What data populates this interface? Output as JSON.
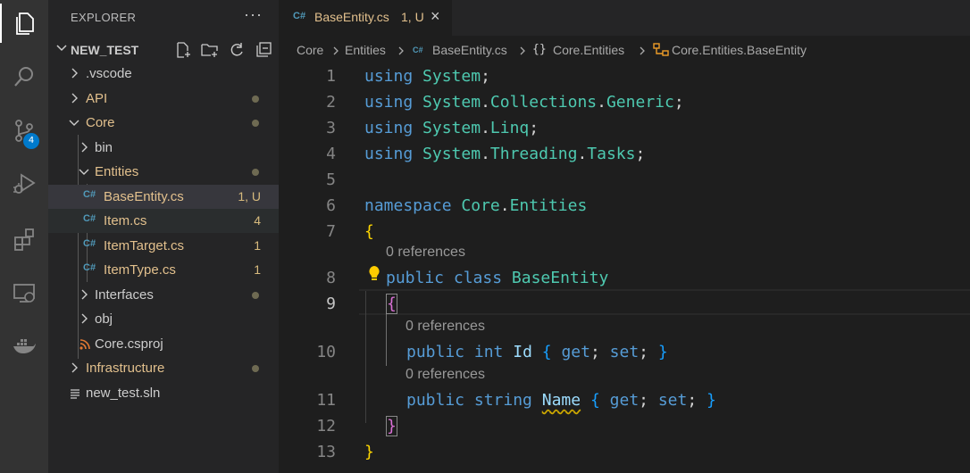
{
  "activity_bar": {
    "items": [
      {
        "name": "explorer",
        "icon": "files-icon",
        "active": true
      },
      {
        "name": "search",
        "icon": "search-icon"
      },
      {
        "name": "source-control",
        "icon": "source-control-icon",
        "badge": "4"
      },
      {
        "name": "run-debug",
        "icon": "run-debug-icon"
      },
      {
        "name": "extensions",
        "icon": "extensions-icon"
      },
      {
        "name": "remote-explorer",
        "icon": "remote-explorer-icon"
      },
      {
        "name": "docker",
        "icon": "docker-icon"
      }
    ]
  },
  "sidebar": {
    "title": "EXPLORER",
    "more": "···",
    "root": "NEW_TEST",
    "tree": [
      {
        "label": ".vscode",
        "type": "folder",
        "status": ""
      },
      {
        "label": "API",
        "type": "folder",
        "status": "dot"
      },
      {
        "label": "Core",
        "type": "folder",
        "status": "dot",
        "open": true
      },
      {
        "label": "bin",
        "type": "folder",
        "status": ""
      },
      {
        "label": "Entities",
        "type": "folder",
        "status": "dot",
        "open": true
      },
      {
        "label": "BaseEntity.cs",
        "type": "cs",
        "status": "1, U"
      },
      {
        "label": "Item.cs",
        "type": "cs",
        "status": "4"
      },
      {
        "label": "ItemTarget.cs",
        "type": "cs",
        "status": "1"
      },
      {
        "label": "ItemType.cs",
        "type": "cs",
        "status": "1"
      },
      {
        "label": "Interfaces",
        "type": "folder",
        "status": "dot"
      },
      {
        "label": "obj",
        "type": "folder",
        "status": ""
      },
      {
        "label": "Core.csproj",
        "type": "rss",
        "status": ""
      },
      {
        "label": "Infrastructure",
        "type": "folder",
        "status": "dot"
      },
      {
        "label": "new_test.sln",
        "type": "sln",
        "status": ""
      }
    ]
  },
  "tab": {
    "icon": "C#",
    "label": "BaseEntity.cs",
    "status": "1, U",
    "close": "×"
  },
  "breadcrumb": {
    "items": [
      "Core",
      "Entities",
      "BaseEntity.cs",
      "Core.Entities",
      "Core.Entities.BaseEntity"
    ],
    "ns_icon": "{}"
  },
  "editor": {
    "lines": [
      {
        "n": "1",
        "tokens": [
          [
            "kw",
            "using"
          ],
          [
            "pl",
            " "
          ],
          [
            "ns",
            "System"
          ],
          [
            "pl",
            ";"
          ]
        ]
      },
      {
        "n": "2",
        "tokens": [
          [
            "kw",
            "using"
          ],
          [
            "pl",
            " "
          ],
          [
            "ns",
            "System"
          ],
          [
            "pl",
            "."
          ],
          [
            "ns",
            "Collections"
          ],
          [
            "pl",
            "."
          ],
          [
            "ns",
            "Generic"
          ],
          [
            "pl",
            ";"
          ]
        ]
      },
      {
        "n": "3",
        "tokens": [
          [
            "kw",
            "using"
          ],
          [
            "pl",
            " "
          ],
          [
            "ns",
            "System"
          ],
          [
            "pl",
            "."
          ],
          [
            "ns",
            "Linq"
          ],
          [
            "pl",
            ";"
          ]
        ]
      },
      {
        "n": "4",
        "tokens": [
          [
            "kw",
            "using"
          ],
          [
            "pl",
            " "
          ],
          [
            "ns",
            "System"
          ],
          [
            "pl",
            "."
          ],
          [
            "ns",
            "Threading"
          ],
          [
            "pl",
            "."
          ],
          [
            "ns",
            "Tasks"
          ],
          [
            "pl",
            ";"
          ]
        ]
      },
      {
        "n": "5",
        "tokens": []
      },
      {
        "n": "6",
        "tokens": [
          [
            "kw",
            "namespace"
          ],
          [
            "pl",
            " "
          ],
          [
            "ns",
            "Core"
          ],
          [
            "pl",
            "."
          ],
          [
            "ns",
            "Entities"
          ]
        ]
      },
      {
        "n": "7",
        "tokens": [
          [
            "br1",
            "{"
          ]
        ]
      },
      {
        "n": "8",
        "tokens": [
          [
            "kw",
            "public"
          ],
          [
            "pl",
            " "
          ],
          [
            "kw",
            "class"
          ],
          [
            "pl",
            " "
          ],
          [
            "ns",
            "BaseEntity"
          ]
        ]
      },
      {
        "n": "9",
        "tokens": [
          [
            "br2",
            "{"
          ]
        ]
      },
      {
        "n": "10",
        "tokens": [
          [
            "kw",
            "public"
          ],
          [
            "pl",
            " "
          ],
          [
            "kw",
            "int"
          ],
          [
            "pl",
            " "
          ],
          [
            "prop",
            "Id"
          ],
          [
            "pl",
            " "
          ],
          [
            "br3",
            "{"
          ],
          [
            "pl",
            " "
          ],
          [
            "kw",
            "get"
          ],
          [
            "pl",
            "; "
          ],
          [
            "kw",
            "set"
          ],
          [
            "pl",
            "; "
          ],
          [
            "br3",
            "}"
          ]
        ]
      },
      {
        "n": "11",
        "tokens": [
          [
            "kw",
            "public"
          ],
          [
            "pl",
            " "
          ],
          [
            "kw",
            "string"
          ],
          [
            "pl",
            " "
          ],
          [
            "prop",
            "Name"
          ],
          [
            "pl",
            " "
          ],
          [
            "br3",
            "{"
          ],
          [
            "pl",
            " "
          ],
          [
            "kw",
            "get"
          ],
          [
            "pl",
            "; "
          ],
          [
            "kw",
            "set"
          ],
          [
            "pl",
            "; "
          ],
          [
            "br3",
            "}"
          ]
        ]
      },
      {
        "n": "12",
        "tokens": [
          [
            "br2",
            "}"
          ]
        ]
      },
      {
        "n": "13",
        "tokens": [
          [
            "br1",
            "}"
          ]
        ]
      }
    ],
    "codelens": [
      "0 references",
      "0 references",
      "0 references"
    ],
    "active_line": "9"
  },
  "colors": {
    "keyword": "#569cd6",
    "type": "#4ec9b0",
    "modified": "#e2c08d",
    "accent": "#007acc"
  }
}
